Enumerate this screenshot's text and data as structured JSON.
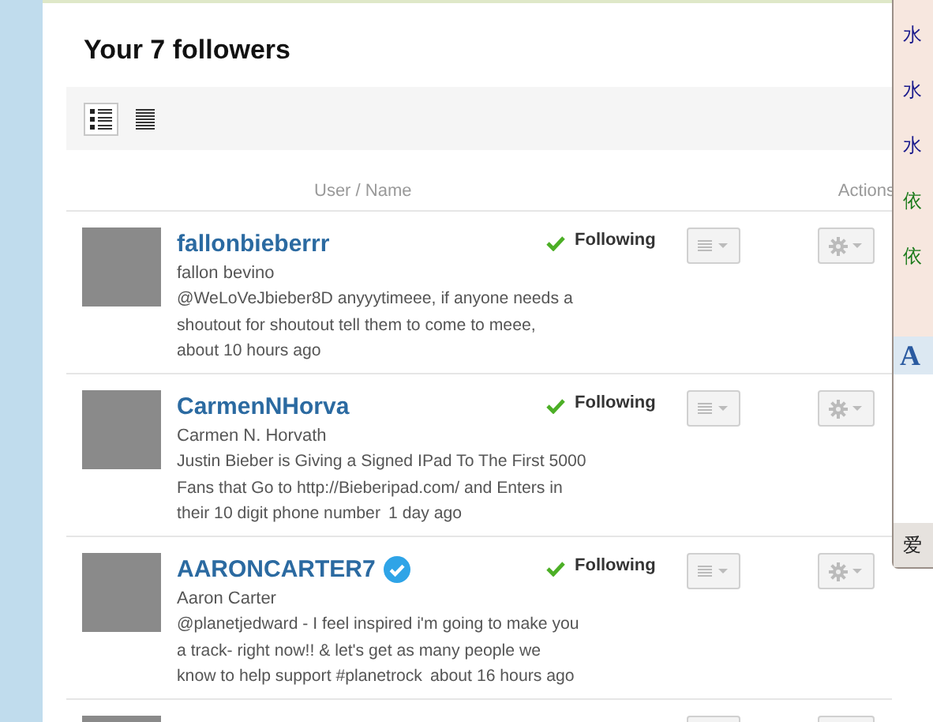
{
  "page": {
    "title": "Your 7 followers"
  },
  "view_toggle": [
    {
      "kind": "detailed",
      "selected": true
    },
    {
      "kind": "compact",
      "selected": false
    }
  ],
  "table": {
    "columns": [
      "User / Name",
      "Actions"
    ]
  },
  "followers": [
    {
      "screen_name": "fallonbieberrr",
      "verified": false,
      "full_name": "fallon bevino",
      "tweet": "@WeLoVeJbieber8D anyyytimeee, if anyone needs a\nshoutout for shoutout tell them to come to meee,",
      "time": "about 10 hours ago",
      "status": "Following"
    },
    {
      "screen_name": "CarmenNHorva",
      "verified": false,
      "full_name": "Carmen N. Horvath",
      "tweet": "Justin Bieber is Giving a Signed IPad To The First 5000\nFans that Go to http://Bieberipad.com/ and Enters in\ntheir 10 digit phone number",
      "time": "1 day ago",
      "status": "Following"
    },
    {
      "screen_name": "AARONCARTER7",
      "verified": true,
      "full_name": "Aaron Carter",
      "tweet": "@planetjedward - I feel inspired i'm going to make you\na track- right now!! & let's get as many people we\nknow to help support #planetrock",
      "time": "about 16 hours ago",
      "status": "Following"
    },
    {
      "cut_off": true
    }
  ],
  "side_panel": {
    "items": [
      {
        "text": "水",
        "color": "#1a1a8c"
      },
      {
        "text": "水",
        "color": "#1a1a8c"
      },
      {
        "text": "水",
        "color": "#1a1a8c"
      },
      {
        "text": "依",
        "color": "#1a7a1a"
      },
      {
        "text": "依",
        "color": "#1a7a1a"
      }
    ],
    "font_button": "A",
    "footer": "爱"
  }
}
